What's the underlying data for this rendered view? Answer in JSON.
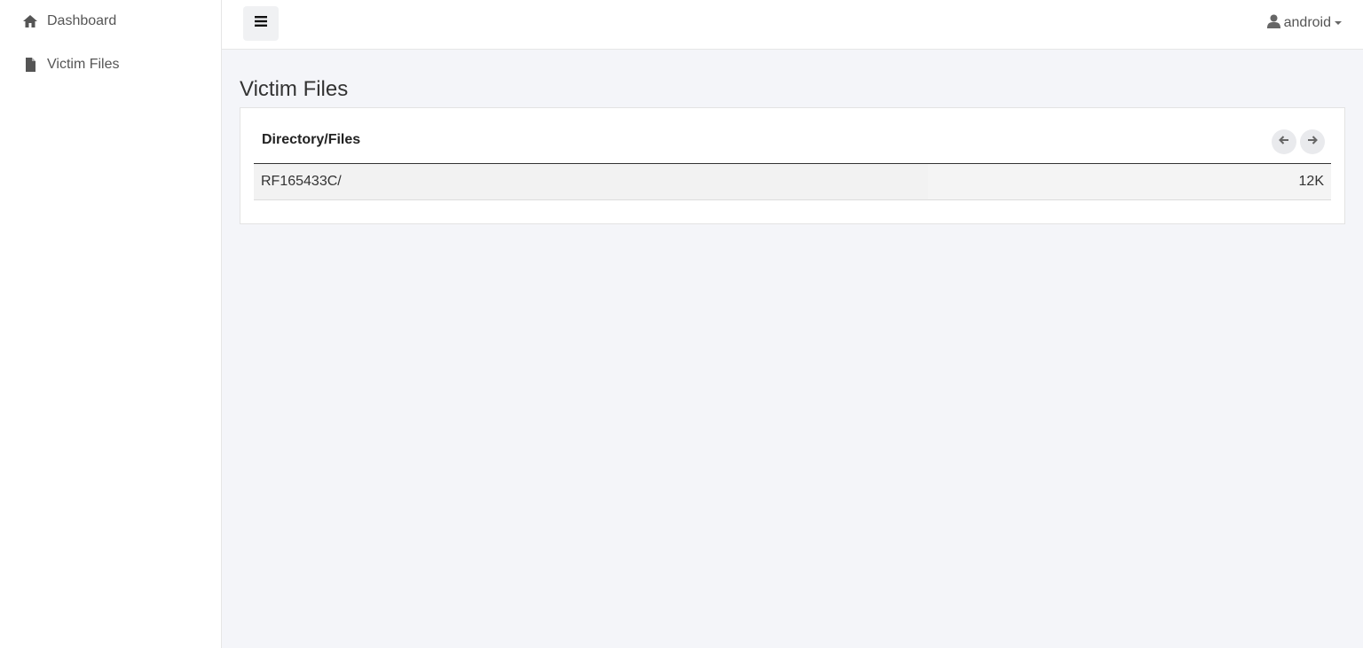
{
  "sidebar": {
    "items": [
      {
        "label": "Dashboard",
        "icon": "home-icon"
      },
      {
        "label": "Victim Files",
        "icon": "file-icon"
      }
    ]
  },
  "header": {
    "menu_toggle_icon": "hamburger-icon",
    "user": {
      "name": "android",
      "icon": "user-icon"
    }
  },
  "main": {
    "title": "Victim Files",
    "panel": {
      "header": "Directory/Files",
      "rows": [
        {
          "name": "RF165433C/",
          "size": "12K"
        }
      ]
    }
  },
  "colors": {
    "background": "#f4f5f9",
    "surface": "#ffffff",
    "row_background": "#f2f2f2"
  }
}
